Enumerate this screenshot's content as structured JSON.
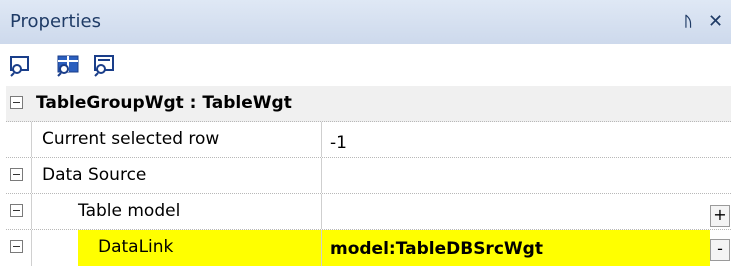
{
  "panel": {
    "title": "Properties",
    "pin_glyph": "ᚢ",
    "close_glyph": "✕"
  },
  "toolbar": {
    "buttons": [
      {
        "icon": "categorized-view-icon"
      },
      {
        "icon": "alphabetical-view-icon"
      },
      {
        "icon": "property-pages-icon"
      }
    ]
  },
  "grid": {
    "header": {
      "label": "TableGroupWgt : TableWgt"
    },
    "rows": [
      {
        "name": "Current selected row",
        "value": "-1"
      },
      {
        "name": "Data Source",
        "value": ""
      },
      {
        "name": "Table model",
        "value": "",
        "button": "+"
      },
      {
        "name": "DataLink",
        "value": "model:TableDBSrcWgt",
        "button": "-",
        "highlight_color": "#ffff00"
      }
    ]
  }
}
